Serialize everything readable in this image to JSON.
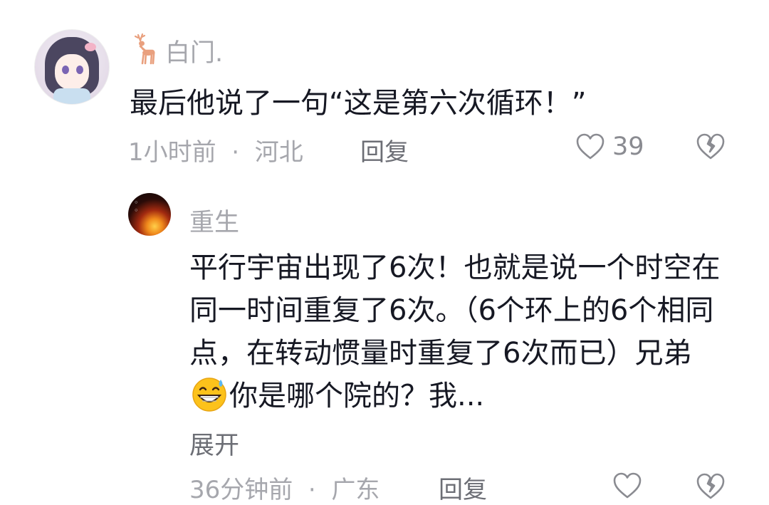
{
  "comment": {
    "user_name": "白门.",
    "text": "最后他说了一句“这是第六次循环！”",
    "time": "1小时前",
    "location": "河北",
    "reply_label": "回复",
    "like_count": "39",
    "name_icon": "deer-icon"
  },
  "reply": {
    "user_name": "重生",
    "text_before_emoji": "平行宇宙出现了6次！也就是说一个时空在同一时间重复了6次。（6个环上的6个相同点，在转动惯量时重复了6次而已）兄弟",
    "emoji": "grinning-sweat-emoji",
    "text_after_emoji": "你是哪个院的？我...",
    "expand_label": "展开",
    "time": "36分钟前",
    "location": "广东",
    "reply_label": "回复"
  },
  "colors": {
    "primary_text": "#161823",
    "secondary_text": "#a6a7ad",
    "action_text": "#6c6e75"
  }
}
